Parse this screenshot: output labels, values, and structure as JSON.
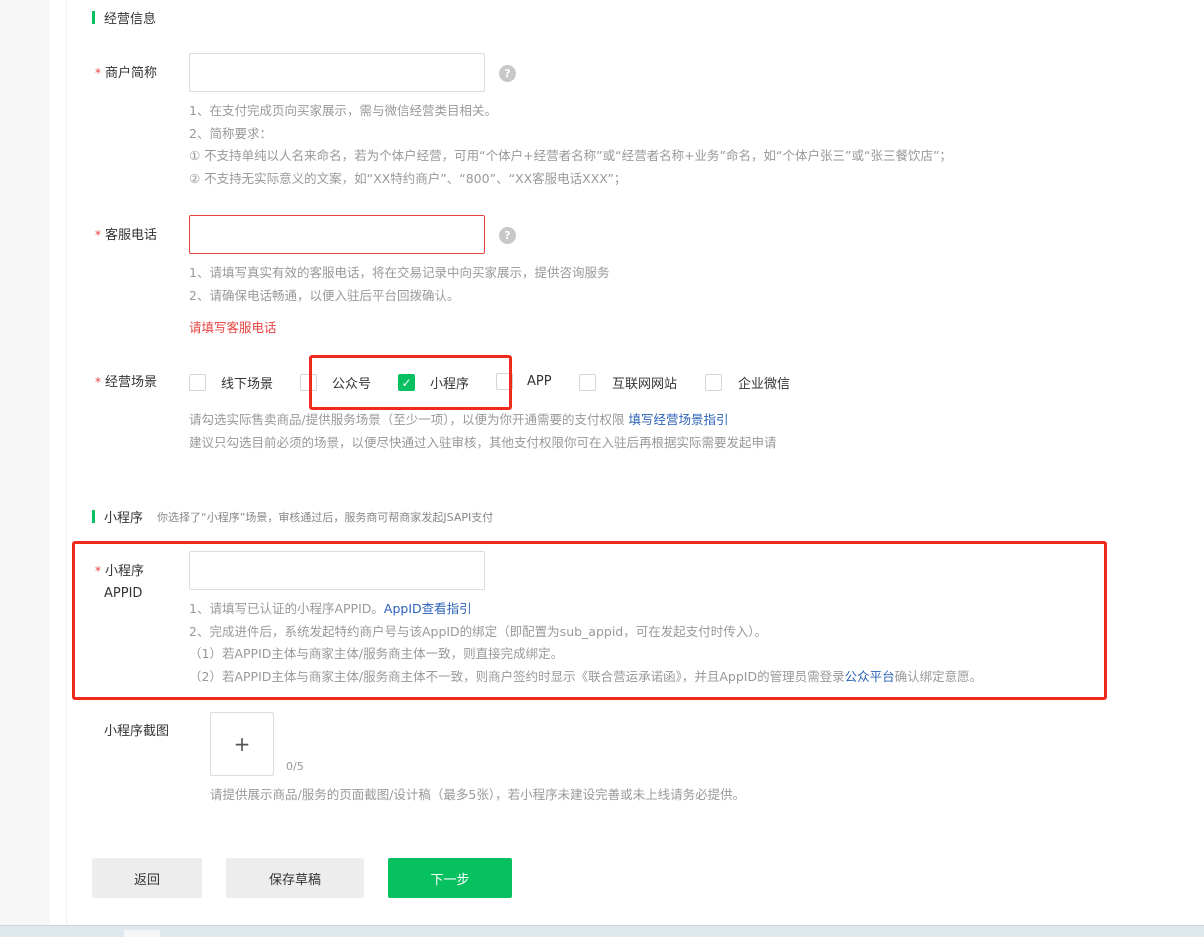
{
  "sections": {
    "business_info": "经营信息",
    "mini_program": "小程序",
    "mini_program_note": "你选择了“小程序”场景，审核通过后，服务商可帮商家发起JSAPI支付"
  },
  "merchant_short_name": {
    "required_mark": "*",
    "label": "商户简称",
    "value": "",
    "help_icon": "question-icon",
    "hints": [
      "1、在支付完成页向买家展示，需与微信经营类目相关。",
      "2、简称要求：",
      "① 不支持单纯以人名来命名，若为个体户经营，可用“个体户+经营者名称”或“经营者名称+业务”命名，如“个体户张三”或“张三餐饮店”；",
      "② 不支持无实际意义的文案，如“XX特约商户”、“800”、“XX客服电话XXX”；"
    ]
  },
  "service_phone": {
    "required_mark": "*",
    "label": "客服电话",
    "value": "",
    "help_icon": "question-icon",
    "hints": [
      "1、请填写真实有效的客服电话，将在交易记录中向买家展示，提供咨询服务",
      "2、请确保电话畅通，以便入驻后平台回拨确认。"
    ],
    "error": "请填写客服电话"
  },
  "scenes": {
    "required_mark": "*",
    "label": "经营场景",
    "options": [
      {
        "label": "线下场景",
        "checked": false
      },
      {
        "label": "公众号",
        "checked": false
      },
      {
        "label": "小程序",
        "checked": true
      },
      {
        "label": "APP",
        "checked": false
      },
      {
        "label": "互联网网站",
        "checked": false
      },
      {
        "label": "企业微信",
        "checked": false
      }
    ],
    "hint1_text": "请勾选实际售卖商品/提供服务场景（至少一项），以便为你开通需要的支付权限",
    "hint1_link": "填写经营场景指引",
    "hint2": "建议只勾选目前必须的场景，以便尽快通过入驻审核，其他支付权限你可在入驻后再根据实际需要发起申请"
  },
  "appid": {
    "required_mark": "*",
    "label_line1": "小程序",
    "label_line2": "APPID",
    "value": "",
    "hint1_text": "1、请填写已认证的小程序APPID。",
    "hint1_link": "AppID查看指引",
    "hint2": "2、完成进件后，系统发起特约商户号与该AppID的绑定（即配置为sub_appid，可在发起支付时传入）。",
    "hint3": "（1）若APPID主体与商家主体/服务商主体一致，则直接完成绑定。",
    "hint4_text": "（2）若APPID主体与商家主体/服务商主体不一致，则商户签约时显示《联合营运承诺函》，并且AppID的管理员需登录",
    "hint4_link": "公众平台",
    "hint4_tail": "确认绑定意愿。"
  },
  "screenshot": {
    "label": "小程序截图",
    "plus": "+",
    "count": "0/5",
    "hint": "请提供展示商品/服务的页面截图/设计稿（最多5张），若小程序未建设完善或未上线请务必提供。"
  },
  "buttons": {
    "back": "返回",
    "save_draft": "保存草稿",
    "next": "下一步"
  },
  "colors": {
    "accent": "#07c160",
    "error": "#e64340",
    "link": "#2d63b8",
    "highlight_frame": "#f02b1c"
  }
}
